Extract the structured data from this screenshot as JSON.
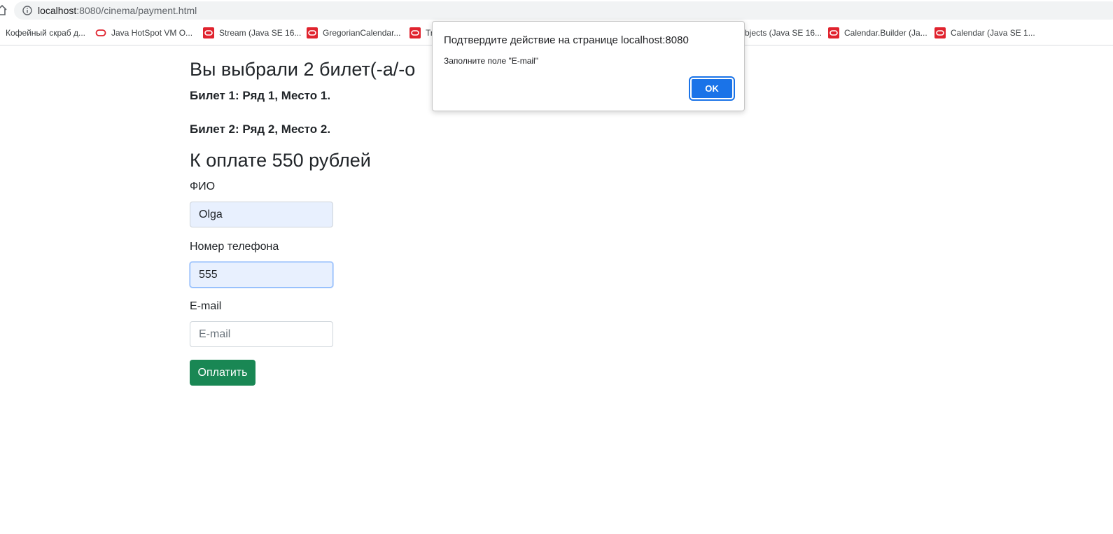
{
  "browser": {
    "url_host": "localhost",
    "url_path": ":8080/cinema/payment.html",
    "bookmarks": [
      {
        "label": "Кофейный скраб д...",
        "icon": "none"
      },
      {
        "label": "Java HotSpot VM O...",
        "icon": "oracle-ring-icon"
      },
      {
        "label": "Stream (Java SE 16...",
        "icon": "oracle-icon"
      },
      {
        "label": "GregorianCalendar...",
        "icon": "oracle-icon"
      },
      {
        "label": "Tr",
        "icon": "oracle-icon"
      },
      {
        "label": "bjects (Java SE 16...",
        "icon": "none"
      },
      {
        "label": "Calendar.Builder (Ja...",
        "icon": "oracle-icon"
      },
      {
        "label": "Calendar (Java SE 1...",
        "icon": "oracle-icon"
      }
    ]
  },
  "page": {
    "heading": "Вы выбрали 2 билет(-а/-о",
    "tickets": [
      "Билет 1: Ряд 1, Место 1.",
      "Билет 2: Ряд 2, Место 2."
    ],
    "total": "К оплате 550 рублей",
    "form": {
      "name_label": "ФИО",
      "name_value": "Olga",
      "phone_label": "Номер телефона",
      "phone_value": "555",
      "email_label": "E-mail",
      "email_placeholder": "E-mail",
      "submit_label": "Оплатить"
    }
  },
  "dialog": {
    "title": "Подтвердите действие на странице localhost:8080",
    "message": "Заполните поле \"E-mail\"",
    "ok_label": "OK"
  },
  "colors": {
    "pay_button": "#198754",
    "dialog_ok": "#1a73e8",
    "autofill_bg": "#e8f0fe",
    "oracle_red": "#e0232e"
  }
}
